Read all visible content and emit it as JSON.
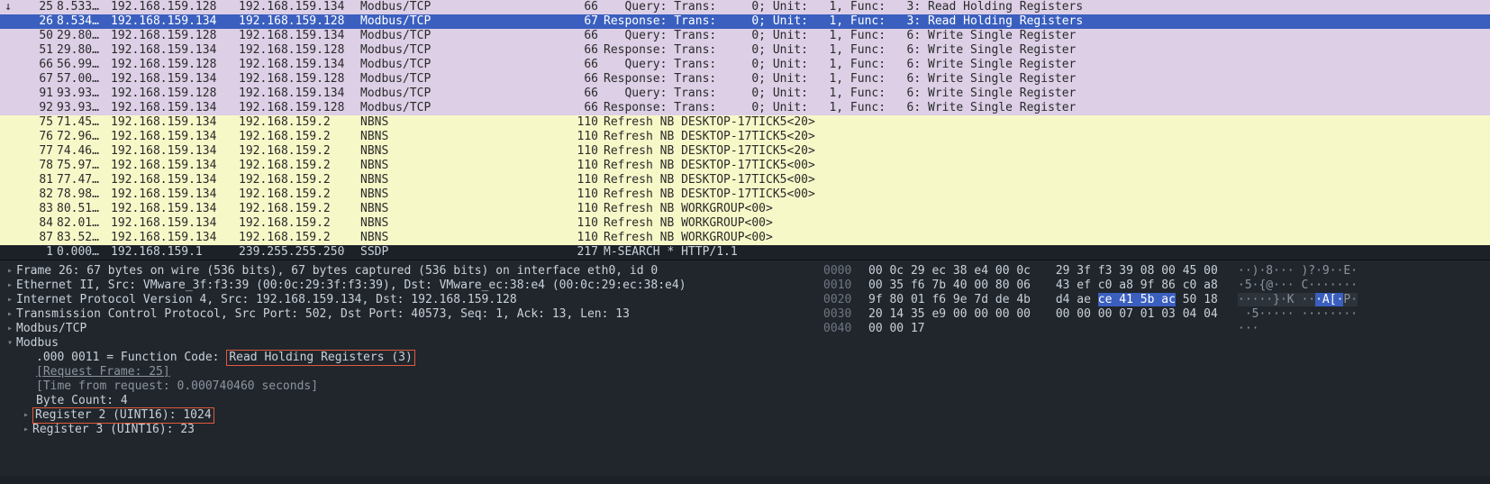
{
  "packets": [
    {
      "no": "25",
      "time": "8.533…",
      "src": "192.168.159.128",
      "dst": "192.168.159.134",
      "proto": "Modbus/TCP",
      "len": "66",
      "info": "   Query: Trans:     0; Unit:   1, Func:   3: Read Holding Registers",
      "cls": "modbus",
      "marker": "↓"
    },
    {
      "no": "26",
      "time": "8.534…",
      "src": "192.168.159.134",
      "dst": "192.168.159.128",
      "proto": "Modbus/TCP",
      "len": "67",
      "info": "Response: Trans:     0; Unit:   1, Func:   3: Read Holding Registers",
      "cls": "modbus selected",
      "marker": ""
    },
    {
      "no": "50",
      "time": "29.80…",
      "src": "192.168.159.128",
      "dst": "192.168.159.134",
      "proto": "Modbus/TCP",
      "len": "66",
      "info": "   Query: Trans:     0; Unit:   1, Func:   6: Write Single Register",
      "cls": "modbus",
      "marker": ""
    },
    {
      "no": "51",
      "time": "29.80…",
      "src": "192.168.159.134",
      "dst": "192.168.159.128",
      "proto": "Modbus/TCP",
      "len": "66",
      "info": "Response: Trans:     0; Unit:   1, Func:   6: Write Single Register",
      "cls": "modbus",
      "marker": ""
    },
    {
      "no": "66",
      "time": "56.99…",
      "src": "192.168.159.128",
      "dst": "192.168.159.134",
      "proto": "Modbus/TCP",
      "len": "66",
      "info": "   Query: Trans:     0; Unit:   1, Func:   6: Write Single Register",
      "cls": "modbus",
      "marker": ""
    },
    {
      "no": "67",
      "time": "57.00…",
      "src": "192.168.159.134",
      "dst": "192.168.159.128",
      "proto": "Modbus/TCP",
      "len": "66",
      "info": "Response: Trans:     0; Unit:   1, Func:   6: Write Single Register",
      "cls": "modbus",
      "marker": ""
    },
    {
      "no": "91",
      "time": "93.93…",
      "src": "192.168.159.128",
      "dst": "192.168.159.134",
      "proto": "Modbus/TCP",
      "len": "66",
      "info": "   Query: Trans:     0; Unit:   1, Func:   6: Write Single Register",
      "cls": "modbus",
      "marker": ""
    },
    {
      "no": "92",
      "time": "93.93…",
      "src": "192.168.159.134",
      "dst": "192.168.159.128",
      "proto": "Modbus/TCP",
      "len": "66",
      "info": "Response: Trans:     0; Unit:   1, Func:   6: Write Single Register",
      "cls": "modbus",
      "marker": ""
    },
    {
      "no": "75",
      "time": "71.45…",
      "src": "192.168.159.134",
      "dst": "192.168.159.2",
      "proto": "NBNS",
      "len": "110",
      "info": "Refresh NB DESKTOP-17TICK5<20>",
      "cls": "nbns",
      "marker": ""
    },
    {
      "no": "76",
      "time": "72.96…",
      "src": "192.168.159.134",
      "dst": "192.168.159.2",
      "proto": "NBNS",
      "len": "110",
      "info": "Refresh NB DESKTOP-17TICK5<20>",
      "cls": "nbns",
      "marker": ""
    },
    {
      "no": "77",
      "time": "74.46…",
      "src": "192.168.159.134",
      "dst": "192.168.159.2",
      "proto": "NBNS",
      "len": "110",
      "info": "Refresh NB DESKTOP-17TICK5<20>",
      "cls": "nbns",
      "marker": ""
    },
    {
      "no": "78",
      "time": "75.97…",
      "src": "192.168.159.134",
      "dst": "192.168.159.2",
      "proto": "NBNS",
      "len": "110",
      "info": "Refresh NB DESKTOP-17TICK5<00>",
      "cls": "nbns",
      "marker": ""
    },
    {
      "no": "81",
      "time": "77.47…",
      "src": "192.168.159.134",
      "dst": "192.168.159.2",
      "proto": "NBNS",
      "len": "110",
      "info": "Refresh NB DESKTOP-17TICK5<00>",
      "cls": "nbns",
      "marker": ""
    },
    {
      "no": "82",
      "time": "78.98…",
      "src": "192.168.159.134",
      "dst": "192.168.159.2",
      "proto": "NBNS",
      "len": "110",
      "info": "Refresh NB DESKTOP-17TICK5<00>",
      "cls": "nbns",
      "marker": ""
    },
    {
      "no": "83",
      "time": "80.51…",
      "src": "192.168.159.134",
      "dst": "192.168.159.2",
      "proto": "NBNS",
      "len": "110",
      "info": "Refresh NB WORKGROUP<00>",
      "cls": "nbns",
      "marker": ""
    },
    {
      "no": "84",
      "time": "82.01…",
      "src": "192.168.159.134",
      "dst": "192.168.159.2",
      "proto": "NBNS",
      "len": "110",
      "info": "Refresh NB WORKGROUP<00>",
      "cls": "nbns",
      "marker": ""
    },
    {
      "no": "87",
      "time": "83.52…",
      "src": "192.168.159.134",
      "dst": "192.168.159.2",
      "proto": "NBNS",
      "len": "110",
      "info": "Refresh NB WORKGROUP<00>",
      "cls": "nbns",
      "marker": ""
    },
    {
      "no": "1",
      "time": "0.000…",
      "src": "192.168.159.1",
      "dst": "239.255.255.250",
      "proto": "SSDP",
      "len": "217",
      "info": "M-SEARCH * HTTP/1.1",
      "cls": "ssdp",
      "marker": ""
    }
  ],
  "details": {
    "frame": "Frame 26: 67 bytes on wire (536 bits), 67 bytes captured (536 bits) on interface eth0, id 0",
    "eth": "Ethernet II, Src: VMware_3f:f3:39 (00:0c:29:3f:f3:39), Dst: VMware_ec:38:e4 (00:0c:29:ec:38:e4)",
    "ip": "Internet Protocol Version 4, Src: 192.168.159.134, Dst: 192.168.159.128",
    "tcp": "Transmission Control Protocol, Src Port: 502, Dst Port: 40573, Seq: 1, Ack: 13, Len: 13",
    "modbus_tcp": "Modbus/TCP",
    "modbus": "Modbus",
    "func_prefix": ".000 0011 = Function Code: ",
    "func_boxed": "Read Holding Registers (3)",
    "request_frame": "[Request Frame: 25]",
    "time_from_request": "[Time from request: 0.000740460 seconds]",
    "byte_count": "Byte Count: 4",
    "reg2": "Register 2 (UINT16): 1024",
    "reg3": "Register 3 (UINT16): 23"
  },
  "bytes": [
    {
      "offset": "0000",
      "h1": "00 0c 29 ec 38 e4 00 0c ",
      "h2": " 29 3f f3 39 08 00 45 00",
      "ascii": "··)·8··· )?·9··E·"
    },
    {
      "offset": "0010",
      "h1": "00 35 f6 7b 40 00 80 06 ",
      "h2": " 43 ef c0 a8 9f 86 c0 a8",
      "ascii": "·5·{@··· C·······"
    },
    {
      "offset": "0020",
      "h1": "9f 80 01 f6 9e 7d de 4b ",
      "h2a": " d4 ae ",
      "h2b": "ce 41 5b ac",
      "h2c": " 50 18",
      "ascii": "·····}·K ··",
      "asciiHL": "·A[·",
      "asciiTail": "P·"
    },
    {
      "offset": "0030",
      "h1": "20 14 35 e9 00 00 00 00 ",
      "h2": " 00 00 00 07 01 03 04 04",
      "ascii": " ·5····· ········"
    },
    {
      "offset": "0040",
      "h1": "00 00 17",
      "h2": "",
      "ascii": "···"
    }
  ]
}
